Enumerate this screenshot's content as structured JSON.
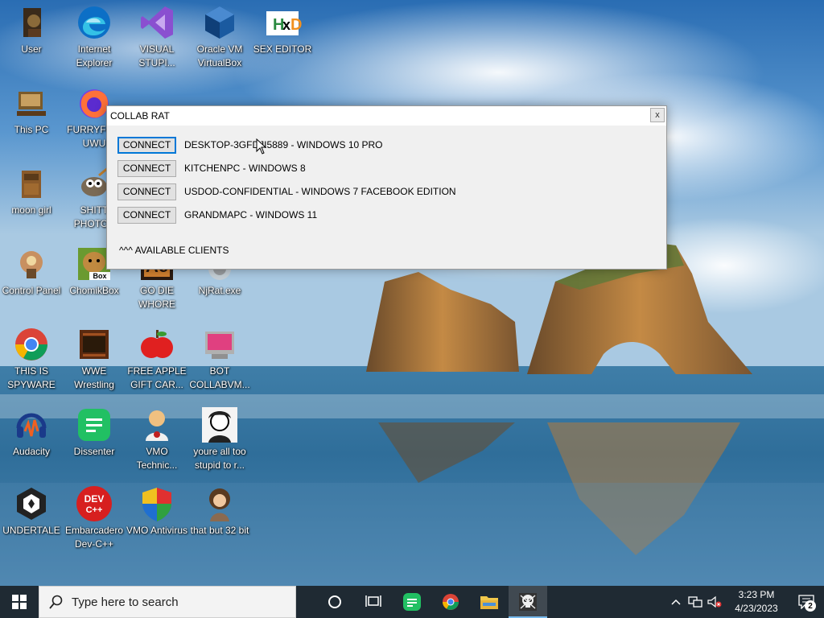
{
  "desktop": {
    "icons": [
      {
        "label": "User",
        "icon": "user-folder-icon"
      },
      {
        "label": "Internet Explorer",
        "icon": "edge-browser-icon"
      },
      {
        "label": "VISUAL STUPI...",
        "icon": "visual-studio-icon"
      },
      {
        "label": "Oracle VM VirtualBox",
        "icon": "virtualbox-icon"
      },
      {
        "label": "SEX EDITOR",
        "icon": "hxd-editor-icon"
      },
      {
        "label": "This PC",
        "icon": "this-pc-icon"
      },
      {
        "label": "FURRYFO... UWU",
        "icon": "firefox-icon"
      },
      {
        "label": "moon girl",
        "icon": "moon-girl-icon"
      },
      {
        "label": "SHITT PHOTOS",
        "icon": "gimp-icon"
      },
      {
        "label": "Control Panel",
        "icon": "control-panel-icon"
      },
      {
        "label": "ChomikBox",
        "icon": "chomikbox-icon"
      },
      {
        "label": "GO DIE WHORE",
        "icon": "go-die-icon"
      },
      {
        "label": "NjRat.exe",
        "icon": "njrat-icon"
      },
      {
        "label": "THIS IS SPYWARE",
        "icon": "chrome-icon"
      },
      {
        "label": "WWE Wrestling",
        "icon": "wwe-wrestling-icon"
      },
      {
        "label": "FREE APPLE GIFT CAR...",
        "icon": "apple-icon"
      },
      {
        "label": "BOT COLLABVM...",
        "icon": "bot-collabvm-icon"
      },
      {
        "label": "Audacity",
        "icon": "audacity-icon"
      },
      {
        "label": "Dissenter",
        "icon": "dissenter-icon"
      },
      {
        "label": "VMO Technic...",
        "icon": "vmo-technician-icon"
      },
      {
        "label": "youre all too stupid to r...",
        "icon": "portrait-icon"
      },
      {
        "label": "UNDERTALE",
        "icon": "unity-icon"
      },
      {
        "label": "Embarcadero Dev-C++",
        "icon": "devcpp-icon"
      },
      {
        "label": "VMO Antivirus",
        "icon": "shield-icon"
      },
      {
        "label": "that but 32 bit",
        "icon": "portrait-lady-icon"
      }
    ]
  },
  "window": {
    "title": "COLLAB RAT",
    "close_label": "x",
    "connect_label": "CONNECT",
    "clients": [
      "DESKTOP-3GFDJI5889 - WINDOWS 10 PRO",
      "KITCHENPC - WINDOWS 8",
      "USDOD-CONFIDENTIAL - WINDOWS 7 FACEBOOK EDITION",
      "GRANDMAPC - WINDOWS 11"
    ],
    "available_label": "^^^ AVAILABLE CLIENTS"
  },
  "taskbar": {
    "search_placeholder": "Type here to search",
    "apps": [
      "cortana-icon",
      "task-view-icon",
      "dissenter-icon",
      "chrome-icon",
      "file-explorer-icon",
      "skull-app-icon"
    ],
    "time": "3:23 PM",
    "date": "4/23/2023",
    "notification_count": "2"
  },
  "colors": {
    "accent": "#0078d7",
    "taskbar_bg": "#1f2a33"
  }
}
